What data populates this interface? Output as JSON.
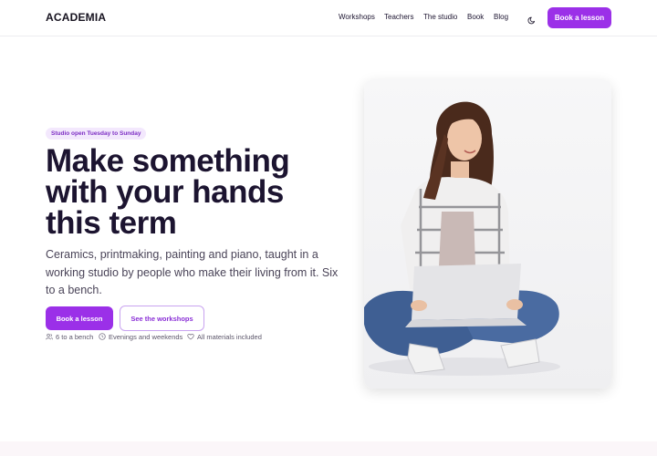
{
  "header": {
    "logo": "ACADEMIA",
    "nav": [
      "Workshops",
      "Teachers",
      "The studio",
      "Book",
      "Blog"
    ],
    "theme_toggle_icon": "moon-icon",
    "cta_label": "Book a lesson"
  },
  "hero": {
    "badge": "Studio open Tuesday to Sunday",
    "headline": "Make something with your hands this term",
    "subtitle": "Ceramics, printmaking, painting and piano, taught in a working studio by people who make their living from it. Six to a bench.",
    "primary_cta": "Book a lesson",
    "secondary_cta": "See the workshops",
    "meta": [
      {
        "icon": "users-icon",
        "text": "6 to a bench"
      },
      {
        "icon": "clock-icon",
        "text": "Evenings and weekends"
      },
      {
        "icon": "heart-icon",
        "text": "All materials included"
      }
    ]
  },
  "colors": {
    "accent": "#9b30e8",
    "badge_bg": "#f3e8fd",
    "text": "#1c1430"
  }
}
